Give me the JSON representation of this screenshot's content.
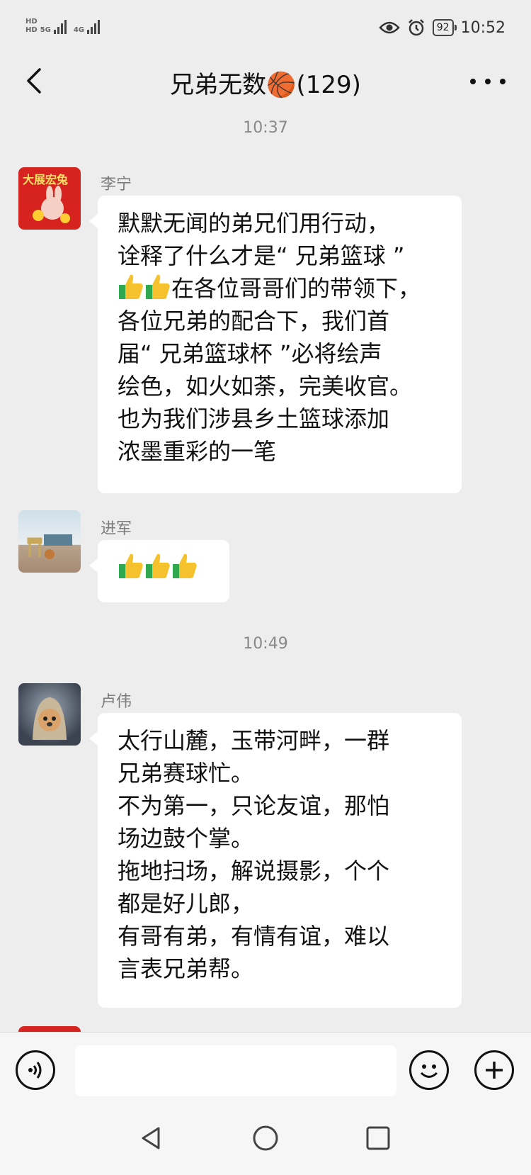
{
  "status_bar": {
    "hd1": "HD",
    "hd2": "HD",
    "net1": "5G",
    "net2": "4G",
    "battery": "92",
    "time": "10:52"
  },
  "chat": {
    "title": "兄弟无数🏀(129)"
  },
  "timestamps": [
    "10:37",
    "10:49"
  ],
  "messages": [
    {
      "sender": "李宁",
      "avatar_text": "大展宏兔",
      "lines": [
        "默默无闻的弟兄们用行动，",
        "诠释了什么才是“ 兄弟篮球 ”",
        "在各位哥哥们的带领下，",
        "各位兄弟的配合下，我们首",
        "届“ 兄弟篮球杯 ”必将绘声",
        "绘色，如火如荼，完美收官。",
        "也为我们涉县乡土篮球添加",
        "浓墨重彩的一笔"
      ]
    },
    {
      "sender": "进军",
      "emoji": "thumbs-up x3"
    },
    {
      "sender": "卢伟",
      "lines": [
        "太行山麓，玉带河畔，一群",
        "兄弟赛球忙。",
        "不为第一，只论友谊，那怕",
        "场边鼓个掌。",
        "拖地扫场，解说摄影，个个",
        "都是好儿郎，",
        "有哥有弟，有情有谊，难以",
        "言表兄弟帮。"
      ]
    }
  ],
  "input": {
    "placeholder": ""
  },
  "icons": {
    "back": "back-chevron-icon",
    "more": "more-dots-icon",
    "voice": "voice-icon",
    "emoji": "emoji-icon",
    "plus": "plus-icon",
    "thumb": "thumbs-up-icon"
  },
  "colors": {
    "background": "#ededed",
    "bubble": "#ffffff",
    "thumb_yellow": "#f5c12c",
    "thumb_green": "#2fa84f"
  }
}
